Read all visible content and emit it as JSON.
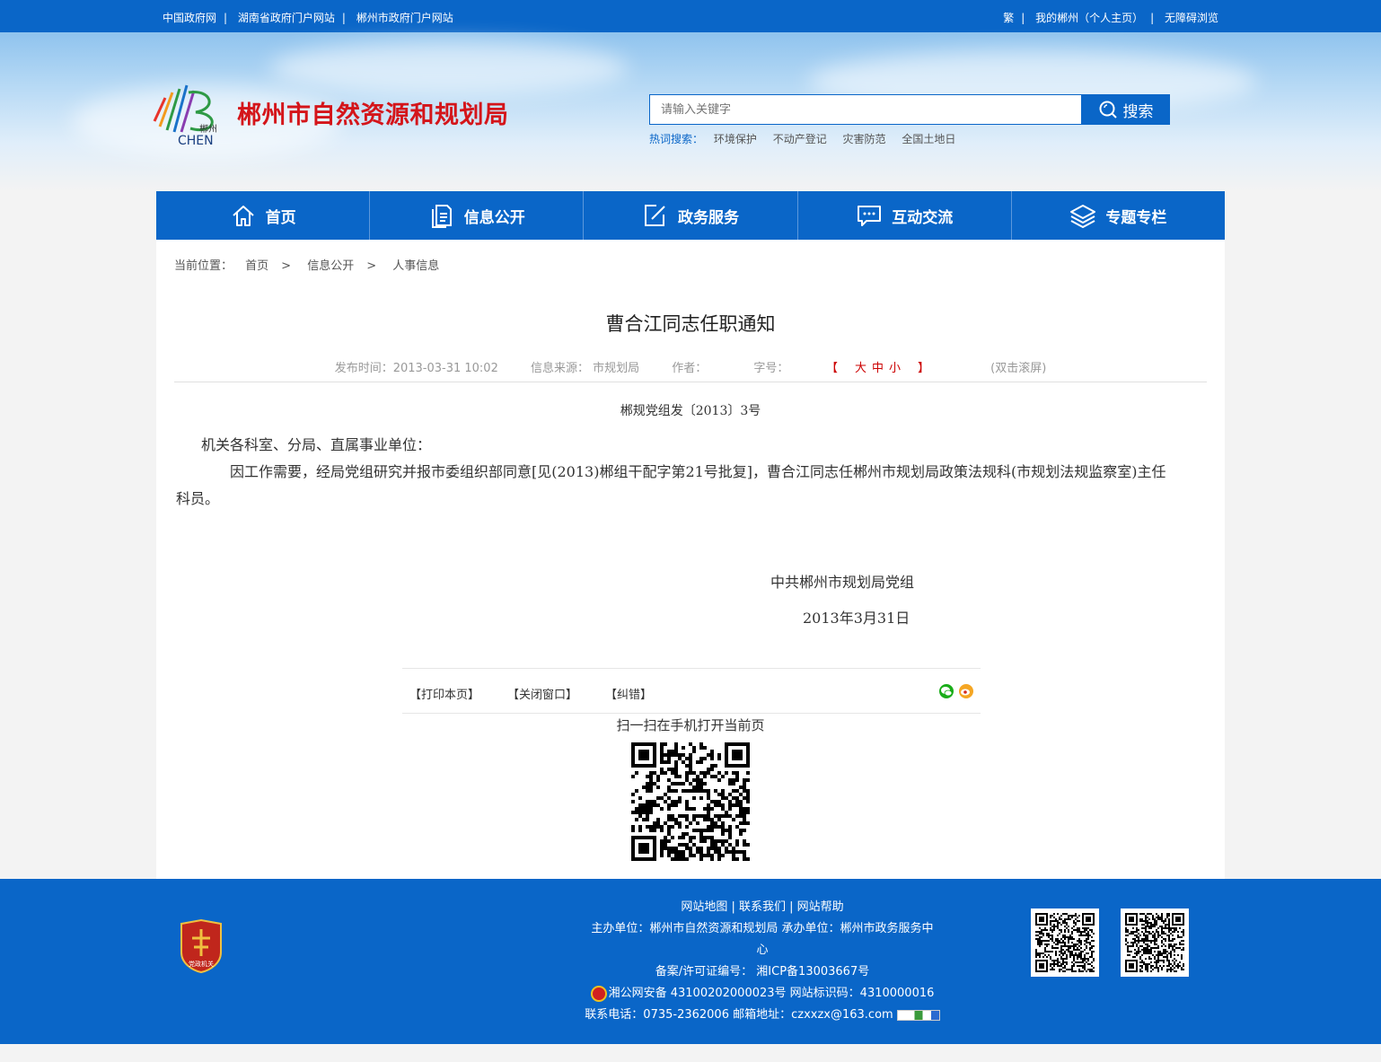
{
  "topbar": {
    "links_left": [
      "中国政府网",
      "湖南省政府门户网站",
      "郴州市政府门户网站"
    ],
    "links_right": [
      "繁",
      "我的郴州（个人主页）",
      "无障碍浏览"
    ]
  },
  "header": {
    "logo_text": "郴州",
    "logo_sub": "CHEN",
    "title": "郴州市自然资源和规划局",
    "search_placeholder": "请输入关键字",
    "search_button": "搜索",
    "hot_label": "热词搜索：",
    "hot_words": [
      "环境保护",
      "不动产登记",
      "灾害防范",
      "全国土地日"
    ]
  },
  "nav": [
    {
      "label": "首页",
      "icon": "home-icon"
    },
    {
      "label": "信息公开",
      "icon": "document-icon"
    },
    {
      "label": "政务服务",
      "icon": "edit-icon"
    },
    {
      "label": "互动交流",
      "icon": "chat-icon"
    },
    {
      "label": "专题专栏",
      "icon": "layers-icon"
    }
  ],
  "breadcrumb": {
    "label": "当前位置：",
    "items": [
      "首页",
      "信息公开",
      "人事信息"
    ],
    "separator": ">"
  },
  "article": {
    "title": "曹合江同志任职通知",
    "publish_time": "发布时间：2013-03-31 10:02",
    "source": "信息来源： 市规划局",
    "author": "作者：",
    "font_size_label": "字号：",
    "font_size_open": "【",
    "font_size_options": [
      "大",
      "中",
      "小"
    ],
    "font_size_close": "】",
    "dblclick": "(双击滚屏)",
    "doc_number": "郴规党组发〔2013〕3号",
    "salutation": "机关各科室、分局、直属事业单位：",
    "paragraph": "因工作需要，经局党组研究并报市委组织部同意[见(2013)郴组干配字第21号批复]，曹合江同志任郴州市规划局政策法规科(市规划法规监察室)主任科员。",
    "signature": "中共郴州市规划局党组",
    "sign_date": "2013年3月31日"
  },
  "tools": {
    "print": "【打印本页】",
    "close": "【关闭窗口】",
    "report": "【纠错】",
    "scan_label": "扫一扫在手机打开当前页"
  },
  "footer": {
    "emblem_text": "党政机关",
    "links": "网站地图 | 联系我们 | 网站帮助",
    "sponsor": "主办单位：郴州市自然资源和规划局    承办单位：郴州市政务服务中",
    "sponsor_cont": "心",
    "icp": "备案/许可证编号： 湘ICP备13003667号",
    "police": "湘公网安备 43100202000023号    网站标识码：4310000016",
    "contact": "联系电话：0735-2362006    邮箱地址：czxxzx@163.com"
  },
  "colors": {
    "primary": "#0a66c8",
    "title_red": "#d4151a"
  }
}
